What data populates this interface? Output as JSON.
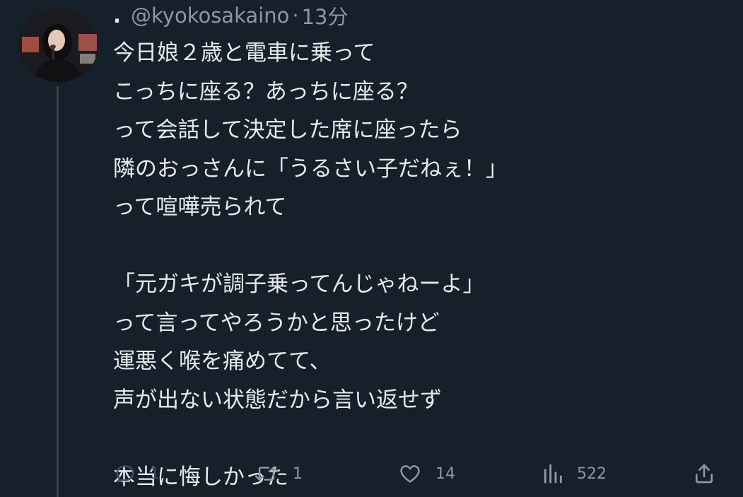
{
  "tweet": {
    "display_name": ".",
    "handle": "@kyokosakaino",
    "separator": "·",
    "time": "13分",
    "body": "今日娘２歳と電車に乗って\nこっちに座る？あっちに座る？\nって会話して決定した席に座ったら\n隣のおっさんに「うるさい子だねぇ！」\nって喧嘩売られて\n\n「元ガキが調子乗ってんじゃねーよ」\nって言ってやろうかと思ったけど\n運悪く喉を痛めてて、\n声が出ない状態だから言い返せず\n\n本当に悔しかった"
  },
  "actions": {
    "reply": {
      "icon": "reply-icon",
      "count": "1"
    },
    "retweet": {
      "icon": "retweet-icon",
      "count": "1"
    },
    "like": {
      "icon": "heart-icon",
      "count": "14"
    },
    "views": {
      "icon": "analytics-icon",
      "count": "522"
    },
    "share": {
      "icon": "share-icon"
    }
  },
  "colors": {
    "background": "#15202b",
    "text": "#e7e9ea",
    "secondary": "#8b98a5",
    "thread_line": "#38444d"
  }
}
